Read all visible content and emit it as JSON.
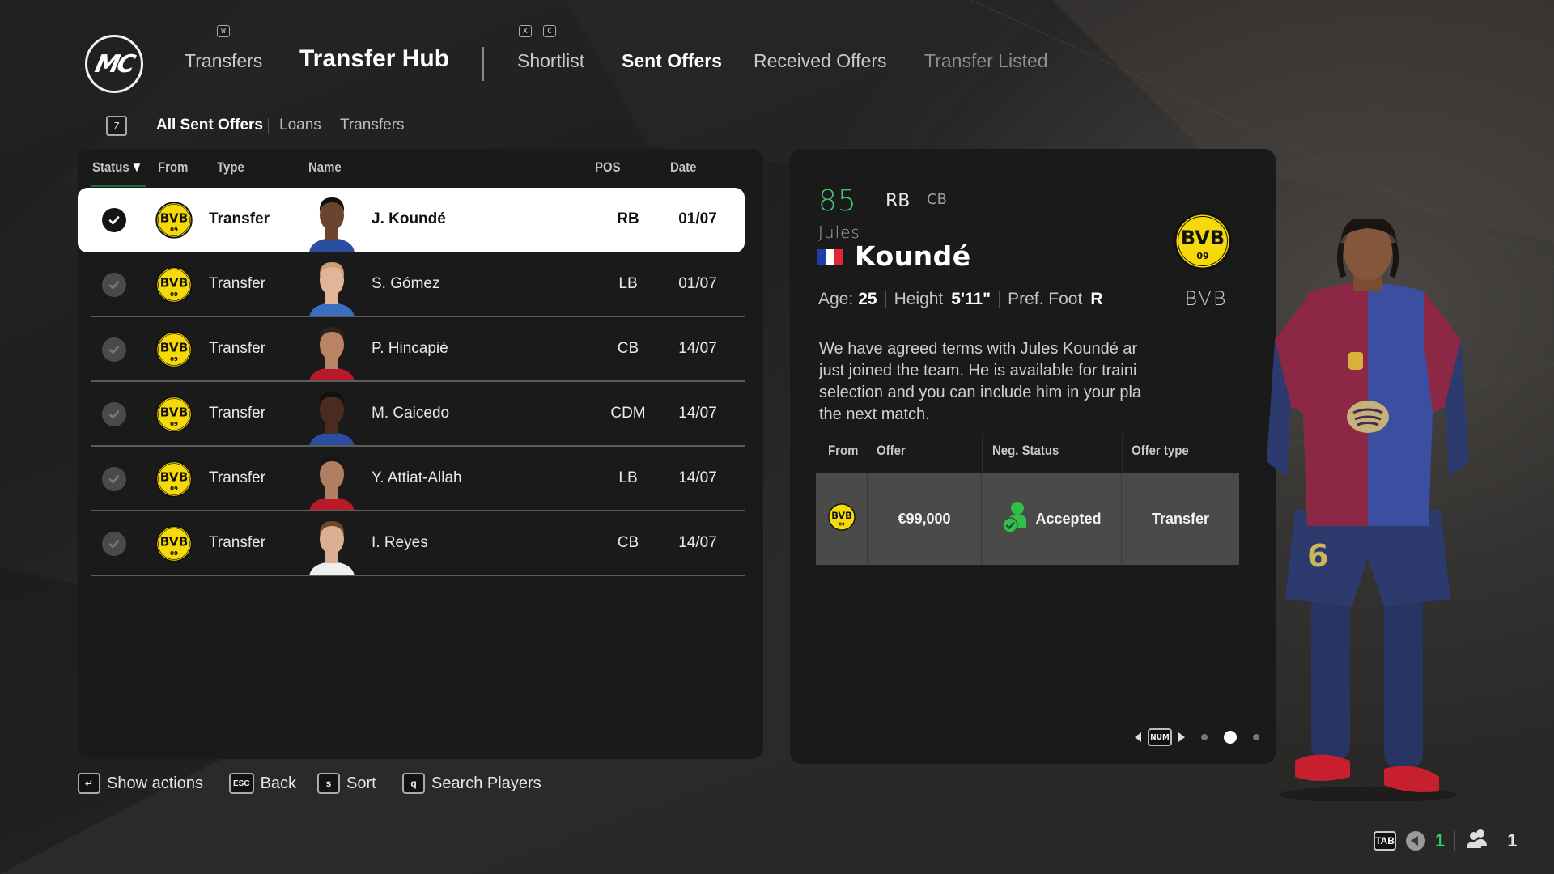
{
  "header": {
    "logo_text": "MC",
    "nav": [
      {
        "label": "Transfers",
        "key": "W"
      },
      {
        "label": "Transfer Hub"
      },
      {
        "label": "Shortlist",
        "key": "X"
      },
      {
        "label": "Sent Offers",
        "key": "C"
      },
      {
        "label": "Received Offers"
      },
      {
        "label": "Transfer Listed"
      }
    ],
    "active_section": "Transfer Hub",
    "active_tab": "Sent Offers"
  },
  "sub_tabs": {
    "key": "Z",
    "items": [
      "All Sent Offers",
      "Loans",
      "Transfers"
    ],
    "active": "All Sent Offers"
  },
  "table": {
    "columns": [
      "Status",
      "From",
      "Type",
      "Name",
      "POS",
      "Date"
    ],
    "sort_column": "Status",
    "sort_indicator": "▼",
    "rows": [
      {
        "status": "accepted",
        "from": "BVB",
        "type": "Transfer",
        "name": "J. Koundé",
        "pos": "RB",
        "date": "01/07",
        "selected": true
      },
      {
        "status": "accepted",
        "from": "BVB",
        "type": "Transfer",
        "name": "S. Gómez",
        "pos": "LB",
        "date": "01/07"
      },
      {
        "status": "accepted",
        "from": "BVB",
        "type": "Transfer",
        "name": "P. Hincapié",
        "pos": "CB",
        "date": "14/07"
      },
      {
        "status": "accepted",
        "from": "BVB",
        "type": "Transfer",
        "name": "M. Caicedo",
        "pos": "CDM",
        "date": "14/07"
      },
      {
        "status": "accepted",
        "from": "BVB",
        "type": "Transfer",
        "name": "Y. Attiat-Allah",
        "pos": "LB",
        "date": "14/07"
      },
      {
        "status": "accepted",
        "from": "BVB",
        "type": "Transfer",
        "name": "I. Reyes",
        "pos": "CB",
        "date": "14/07"
      }
    ]
  },
  "detail": {
    "rating": "85",
    "position": "RB",
    "alt_position": "CB",
    "first_name": "Jules",
    "last_name": "Koundé",
    "nationality": "France",
    "age_label": "Age:",
    "age": "25",
    "height_label": "Height",
    "height": "5'11\"",
    "foot_label": "Pref. Foot",
    "foot": "R",
    "club_abbr": "BVB",
    "description_lines": [
      "We have agreed terms with Jules Koundé ar",
      "just joined the team. He is available for traini",
      "selection and you can include him in your pla",
      "the next match."
    ],
    "offer_table": {
      "columns": [
        "From",
        "Offer",
        "Neg. Status",
        "Offer type"
      ],
      "row": {
        "from": "BVB",
        "offer": "€99,000",
        "neg_status": "Accepted",
        "offer_type": "Transfer"
      }
    },
    "pager": {
      "key": "NUM",
      "pages": 3,
      "current": 2
    }
  },
  "footer_hints": [
    {
      "key": "↵",
      "label": "Show actions"
    },
    {
      "key": "ESC",
      "label": "Back"
    },
    {
      "key": "s",
      "label": "Sort"
    },
    {
      "key": "q",
      "label": "Search Players"
    }
  ],
  "status_bar": {
    "tab_key": "TAB",
    "voice_count": "1",
    "players_count": "1"
  },
  "colors": {
    "accent_green": "#3ec86b",
    "accepted_green": "#2fbf4a",
    "bvb_yellow": "#f5d90a",
    "panel_bg": "#1a1a1a",
    "selected_row_bg": "#ffffff"
  }
}
